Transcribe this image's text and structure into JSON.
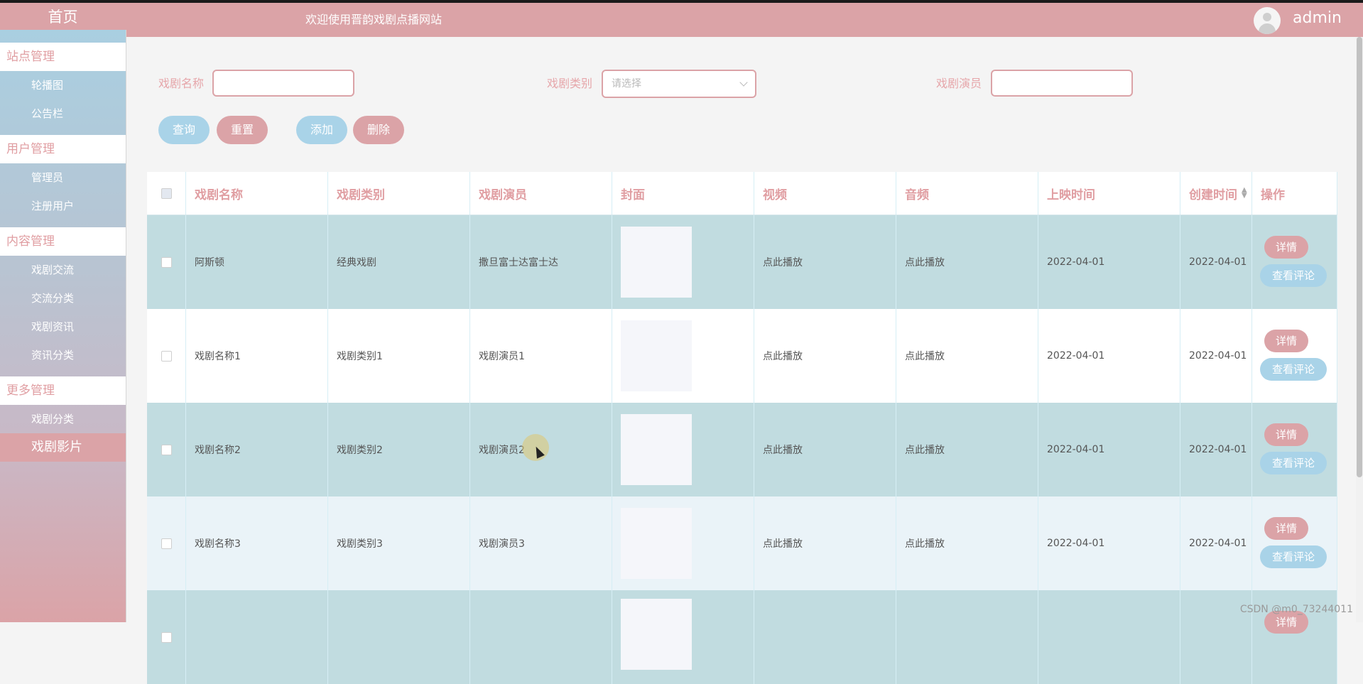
{
  "header": {
    "home_label": "首页",
    "welcome": "欢迎使用晋韵戏剧点播网站",
    "user": "admin"
  },
  "sidebar": {
    "groups": [
      {
        "title": "站点管理",
        "items": [
          "轮播图",
          "公告栏"
        ]
      },
      {
        "title": "用户管理",
        "items": [
          "管理员",
          "注册用户"
        ]
      },
      {
        "title": "内容管理",
        "items": [
          "戏剧交流",
          "交流分类",
          "戏剧资讯",
          "资讯分类"
        ]
      },
      {
        "title": "更多管理",
        "items": [
          "戏剧分类",
          "戏剧影片"
        ]
      }
    ],
    "active_item": "戏剧影片"
  },
  "search": {
    "name_label": "戏剧名称",
    "name_value": "",
    "category_label": "戏剧类别",
    "category_placeholder": "请选择",
    "actor_label": "戏剧演员",
    "actor_value": ""
  },
  "buttons": {
    "query": "查询",
    "reset": "重置",
    "add": "添加",
    "delete": "删除"
  },
  "table": {
    "columns": [
      "戏剧名称",
      "戏剧类别",
      "戏剧演员",
      "封面",
      "视频",
      "音频",
      "上映时间",
      "创建时间",
      "操作"
    ],
    "detail_label": "详情",
    "comment_label": "查看评论",
    "rows": [
      {
        "name": "阿斯顿",
        "category": "经典戏剧",
        "actor": "撒旦富士达富士达",
        "video": "点此播放",
        "audio": "点此播放",
        "release": "2022-04-01",
        "created": "2022-04-01"
      },
      {
        "name": "戏剧名称1",
        "category": "戏剧类别1",
        "actor": "戏剧演员1",
        "video": "点此播放",
        "audio": "点此播放",
        "release": "2022-04-01",
        "created": "2022-04-01"
      },
      {
        "name": "戏剧名称2",
        "category": "戏剧类别2",
        "actor": "戏剧演员2",
        "video": "点此播放",
        "audio": "点此播放",
        "release": "2022-04-01",
        "created": "2022-04-01"
      },
      {
        "name": "戏剧名称3",
        "category": "戏剧类别3",
        "actor": "戏剧演员3",
        "video": "点此播放",
        "audio": "点此播放",
        "release": "2022-04-01",
        "created": "2022-04-01"
      },
      {
        "name": "",
        "category": "",
        "actor": "",
        "video": "",
        "audio": "",
        "release": "",
        "created": ""
      }
    ]
  },
  "watermark": "CSDN @m0_73244011",
  "colors": {
    "accent_pink": "#dba3a7",
    "accent_blue": "#a9d3e8",
    "row_teal": "#c1dce0"
  }
}
